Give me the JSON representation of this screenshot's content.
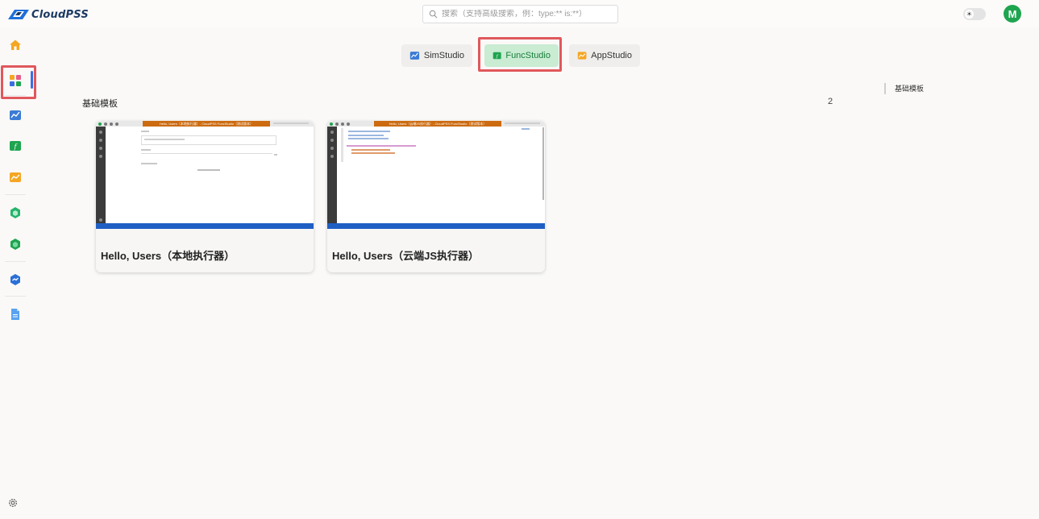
{
  "app": {
    "logo_text": "CloudPSS"
  },
  "search": {
    "placeholder": "搜索（支持高级搜索，例：type:** is:**）"
  },
  "user": {
    "avatar_letter": "M"
  },
  "tabs": [
    {
      "label": "SimStudio",
      "active": false
    },
    {
      "label": "FuncStudio",
      "active": true
    },
    {
      "label": "AppStudio",
      "active": false
    }
  ],
  "section": {
    "title": "基础模板",
    "count": "2"
  },
  "toc": {
    "items": [
      "基础模板"
    ]
  },
  "cards": [
    {
      "title": "Hello, Users（本地执行器）",
      "thumb": {
        "window_title": "Hello, Users（本地执行器）- CloudPSS FuncStudio（测试版本）"
      }
    },
    {
      "title": "Hello, Users（云端JS执行器）",
      "thumb": {
        "window_title": "Hello, Users（云端JS执行器）- CloudPSS FuncStudio（测试版本）"
      }
    }
  ],
  "colors": {
    "accent_blue": "#3a6fe0",
    "func_green": "#1fa44f",
    "highlight_red": "#e0585c",
    "thumb_orange": "#cc6b10"
  },
  "icons": {
    "sidebar": [
      "home-icon",
      "apps-icon",
      "simstudio-icon",
      "funcstudio-icon",
      "appstudio-icon",
      "hexagon-green-icon",
      "hexagon-green-alt-icon",
      "cube-blue-icon",
      "document-icon"
    ],
    "settings": "gear-icon"
  }
}
